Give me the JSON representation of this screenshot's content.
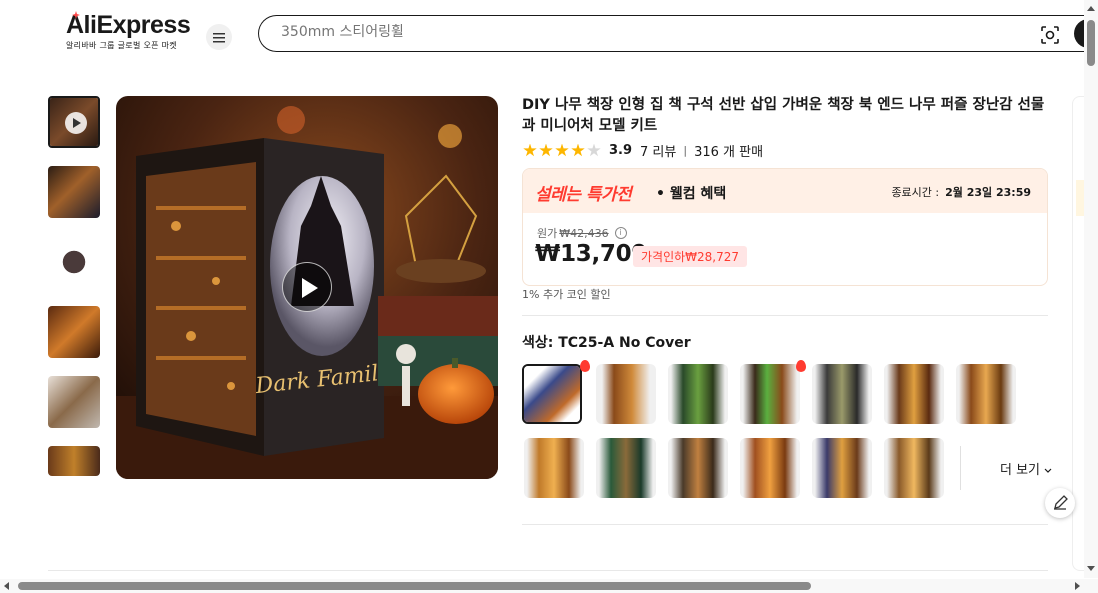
{
  "header": {
    "logo_text": "AliExpress",
    "logo_subtitle": "알리바바 그룹 글로벌 오픈 마켓",
    "search_placeholder": "350mm 스티어링휠"
  },
  "product": {
    "title": "DIY 나무 책장 인형 집 책 구석 선반 삽입 가벼운 책장 북 엔드 나무 퍼즐 장난감 선물과 미니어처 모델 키트",
    "rating": "3.9",
    "rating_stars": 4,
    "reviews": "7 리뷰",
    "sold": "316 개 판매",
    "promo_brand": "설레는 특가전",
    "promo_tag": "• 웰컴 혜택",
    "promo_end_label": "종료시간 :",
    "promo_end_time": "2월 23일 23:59",
    "original_label": "원가",
    "original_price": "₩42,436",
    "price": "₩13,709",
    "discount": "가격인하₩28,727",
    "coin": "1% 추가 코인 할인",
    "color_label": "색상: TC25-A No Cover",
    "more_label": "더 보기"
  },
  "main_image": {
    "cover_text": "Dark Family"
  },
  "colors": {
    "accent_red": "#ff3b30",
    "star": "#fdb600",
    "promo_bg": "#fff0e6"
  }
}
